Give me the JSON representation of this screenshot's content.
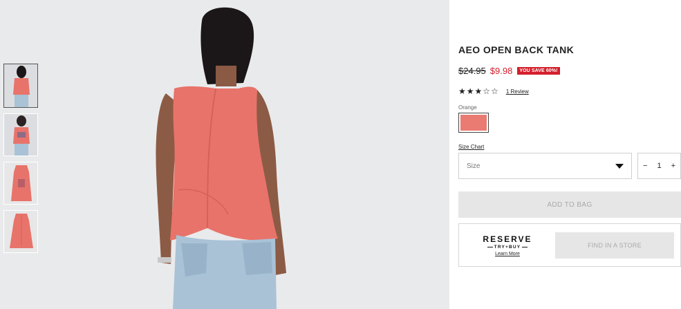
{
  "product": {
    "title": "AEO OPEN BACK TANK",
    "old_price": "$24.95",
    "new_price": "$9.98",
    "save_badge": "YOU SAVE 60%!",
    "rating": {
      "stars_filled": 3,
      "stars_total": 5,
      "review_link": "1 Review"
    },
    "color_label": "Orange",
    "swatch_color": "#ea7b73",
    "size_chart_link": "Size Chart",
    "size_placeholder": "Size",
    "quantity": {
      "minus": "−",
      "value": "1",
      "plus": "+"
    },
    "add_to_bag": "ADD TO BAG"
  },
  "store": {
    "reserve_title": "RESERVE",
    "reserve_sub": "TRY+BUY",
    "learn_more": "Learn More",
    "find_store": "FIND IN A STORE"
  },
  "colors": {
    "sale_red": "#d31f2b",
    "tank_coral": "#e8736a",
    "disabled_button": "#e6e6e6"
  }
}
